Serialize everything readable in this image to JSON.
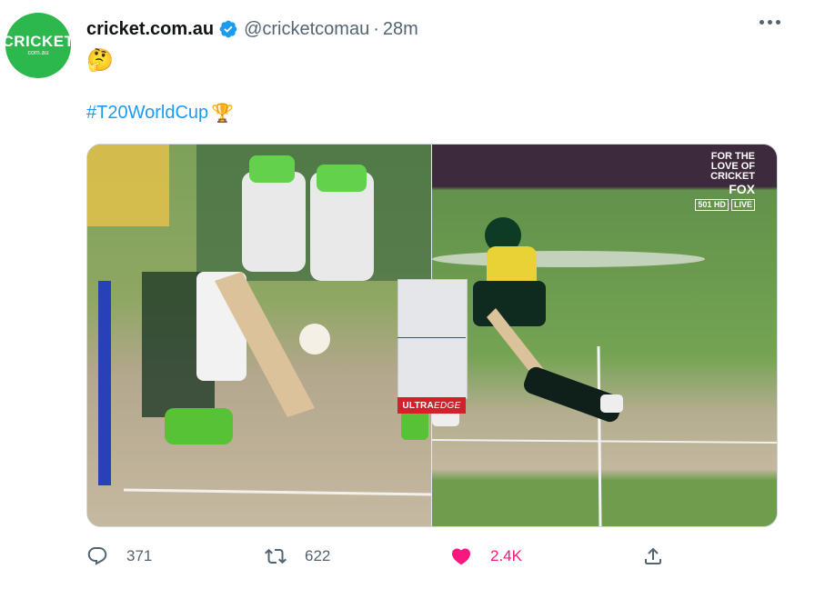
{
  "tweet": {
    "avatar": {
      "brand": "CRICKET",
      "sub": "com.au"
    },
    "display_name": "cricket.com.au",
    "handle": "@cricketcomau",
    "separator": "·",
    "time": "28m",
    "text_emoji": "🤔",
    "hashtag": "#T20WorldCup",
    "hashtag_emoji": "🏆"
  },
  "media": {
    "ultraedge_label_a": "ULTRA",
    "ultraedge_label_b": "EDGE",
    "broadcaster": {
      "line1": "FOR THE",
      "line2": "LOVE OF",
      "line3": "CRICKET",
      "brand": "FOX",
      "channel": "501 HD",
      "live": "LIVE"
    }
  },
  "actions": {
    "replies": "371",
    "retweets": "622",
    "likes": "2.4K"
  },
  "colors": {
    "accent": "#1d9bf0",
    "like": "#f91880",
    "avatar_bg": "#2db84d"
  },
  "icons": [
    "verified-badge-icon",
    "more-options-icon",
    "reply-icon",
    "retweet-icon",
    "like-heart-icon",
    "share-icon"
  ]
}
